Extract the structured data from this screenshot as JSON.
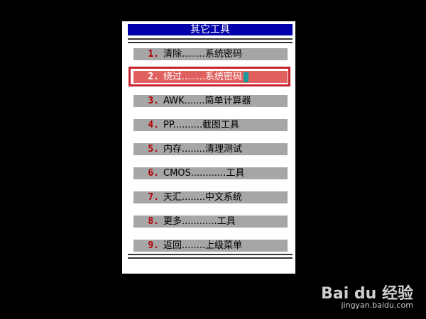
{
  "menu": {
    "title": "其它工具",
    "items": [
      {
        "num": "1.",
        "text": "清除........系统密码"
      },
      {
        "num": "2.",
        "text": "绕过........系统密码"
      },
      {
        "num": "3.",
        "text": "AWK.......简单计算器"
      },
      {
        "num": "4.",
        "text": "PP..........截图工具"
      },
      {
        "num": "5.",
        "text": "内存........清理测试"
      },
      {
        "num": "6.",
        "text": "CMOS............工具"
      },
      {
        "num": "7.",
        "text": "天汇........中文系统"
      },
      {
        "num": "8.",
        "text": "更多............工具"
      },
      {
        "num": "9.",
        "text": "返回........上级菜单"
      }
    ],
    "selected_index": 1
  },
  "colors": {
    "background": "#000000",
    "title_bar": "#0000aa",
    "item_bg": "#a6a6a6",
    "selected_bg": "#e06060",
    "highlight_box": "#c8232c",
    "number": "#b00000"
  },
  "watermark": {
    "logo": "Bai du 经验",
    "url": "jingyan.baidu.com"
  }
}
